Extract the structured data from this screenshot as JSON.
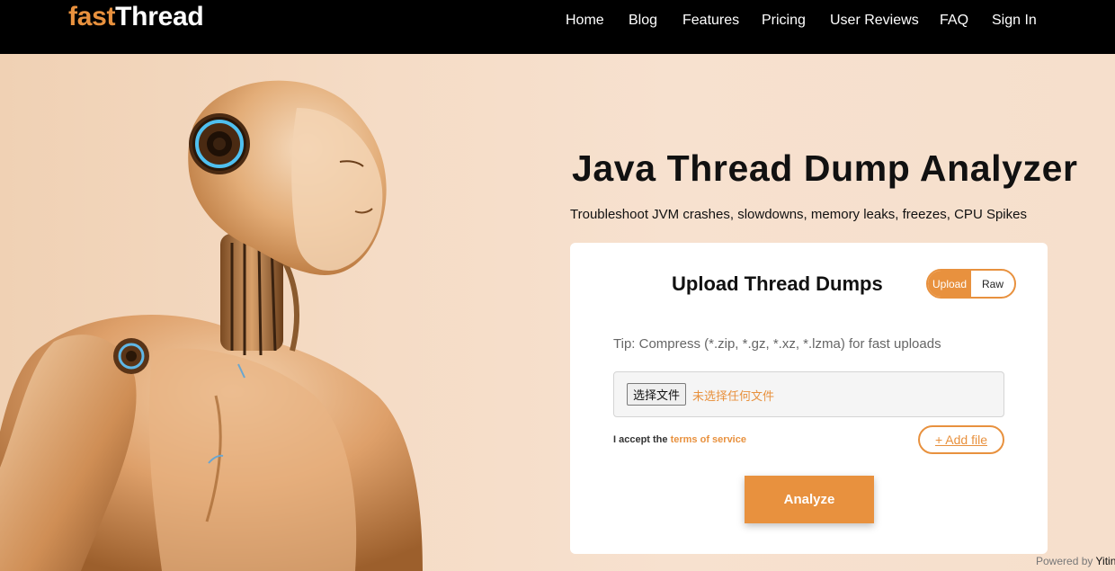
{
  "header": {
    "logo_part1": "fast",
    "logo_part2": "Thread",
    "nav": [
      "Home",
      "Blog",
      "Features",
      "Pricing",
      "User Reviews",
      "FAQ",
      "Sign In"
    ]
  },
  "hero": {
    "title": "Java Thread Dump Analyzer",
    "subtitle": "Troubleshoot JVM crashes, slowdowns, memory leaks, freezes, CPU Spikes"
  },
  "upload_card": {
    "title": "Upload Thread Dumps",
    "toggle": {
      "upload_label": "Upload",
      "raw_label": "Raw",
      "active": "Upload"
    },
    "tip": "Tip: Compress (*.zip, *.gz, *.xz, *.lzma) for fast uploads",
    "file_button_label": "选择文件",
    "no_file_text": "未选择任何文件",
    "terms_prefix": "I accept the",
    "terms_link": "terms of service",
    "add_file_label": "+ Add file",
    "analyze_label": "Analyze"
  },
  "footer": {
    "powered_prefix": "Powered by",
    "powered_brand": "Yitin"
  },
  "colors": {
    "accent": "#e8913e",
    "nav_bg": "#000000",
    "hero_bg": "#f3dcc8"
  }
}
